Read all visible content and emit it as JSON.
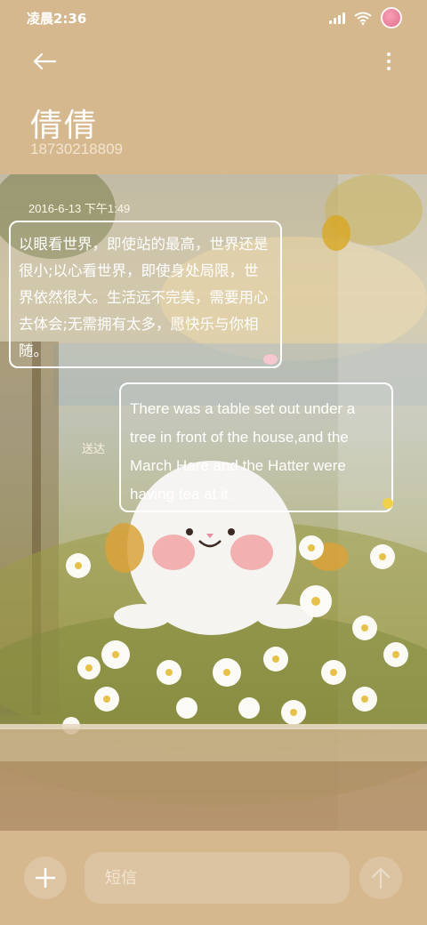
{
  "status_bar": {
    "time": "凌晨2:36"
  },
  "header": {
    "contact_name": "倩倩",
    "contact_number": "18730218809"
  },
  "conversation": {
    "timestamp": "2016-6-13 下午1:49",
    "messages": [
      {
        "direction": "incoming",
        "text": "以眼看世界，即使站的最高，世界还是很小;以心看世界，即使身处局限，世界依然很大。生活远不完美，需要用心去体会;无需拥有太多，愿快乐与你相随。"
      },
      {
        "direction": "outgoing",
        "text": "There was a table set out under a tree in front of the house,and the March Hare and the Hatter were having tea at it.",
        "status": "送达"
      }
    ]
  },
  "input_bar": {
    "placeholder": "短信"
  },
  "icons": {
    "back": "back-arrow-icon",
    "more": "more-vertical-icon",
    "add": "plus-icon",
    "send": "send-arrow-icon",
    "wifi": "wifi-icon",
    "signal": "signal-icon"
  },
  "colors": {
    "accent": "#d6b88f",
    "text": "#ffffff"
  }
}
